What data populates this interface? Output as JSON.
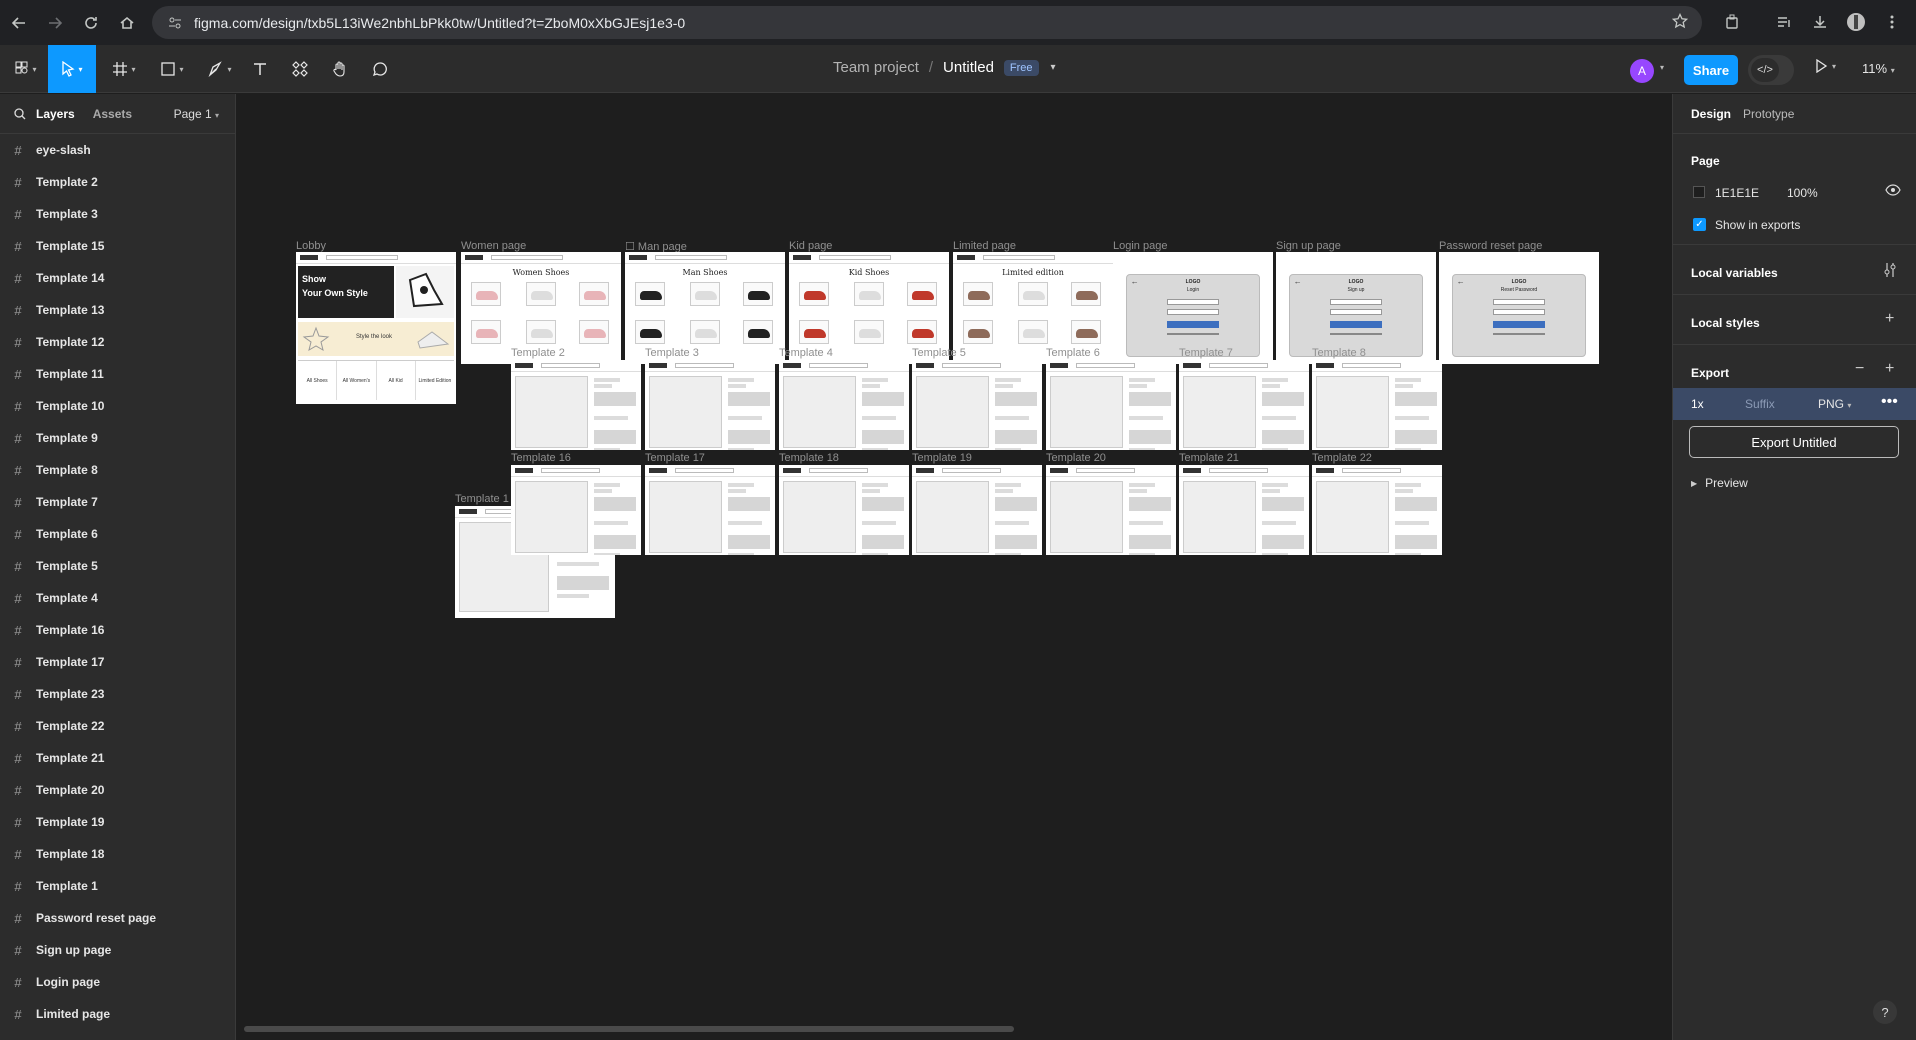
{
  "browser": {
    "url": "figma.com/design/txb5L13iWe2nbhLbPkk0tw/Untitled?t=ZboM0xXbGJEsj1e3-0"
  },
  "toolbar": {
    "team_name": "Team project",
    "separator": "/",
    "file_name": "Untitled",
    "plan_badge": "Free",
    "avatar_initial": "A",
    "share_label": "Share",
    "zoom": "11%"
  },
  "left_panel": {
    "tab_layers": "Layers",
    "tab_assets": "Assets",
    "page_select": "Page 1",
    "layers": [
      "eye-slash",
      "Template 2",
      "Template 3",
      "Template 15",
      "Template 14",
      "Template 13",
      "Template 12",
      "Template 11",
      "Template 10",
      "Template 9",
      "Template 8",
      "Template 7",
      "Template 6",
      "Template 5",
      "Template 4",
      "Template 16",
      "Template 17",
      "Template 23",
      "Template 22",
      "Template 21",
      "Template 20",
      "Template 19",
      "Template 18",
      "Template 1",
      "Password reset page",
      "Sign up page",
      "Login page",
      "Limited page"
    ]
  },
  "canvas": {
    "frames": {
      "lobby": "Lobby",
      "women": "Women page",
      "man": "Man page",
      "kid": "Kid page",
      "limited": "Limited page",
      "login": "Login page",
      "signup": "Sign up page",
      "reset": "Password reset page",
      "t1": "Template 1",
      "row2": [
        "Template 2",
        "Template 3",
        "Template 4",
        "Template 5",
        "Template 6",
        "Template 7",
        "Template 8"
      ],
      "row3": [
        "Template 16",
        "Template 17",
        "Template 18",
        "Template 19",
        "Template 20",
        "Template 21",
        "Template 22"
      ]
    },
    "frame_contents": {
      "lobby_hero_line1": "Show",
      "lobby_hero_line2": "Your Own Style",
      "lobby_banner": "Style the look",
      "lobby_categories": [
        "All Shoes",
        "All Women's",
        "All Kid",
        "Limited Edition"
      ],
      "women_heading": "Women Shoes",
      "man_heading": "Man Shoes",
      "kid_heading": "Kid Shoes",
      "limited_heading": "Limited edition",
      "login_heading": "Login",
      "signup_heading": "Sign up",
      "reset_heading": "Reset Password"
    }
  },
  "right_panel": {
    "tab_design": "Design",
    "tab_prototype": "Prototype",
    "page_heading": "Page",
    "page_color": "1E1E1E",
    "page_opacity": "100%",
    "show_in_exports": "Show in exports",
    "local_variables": "Local variables",
    "local_styles": "Local styles",
    "export_heading": "Export",
    "export_scale": "1x",
    "export_suffix": "Suffix",
    "export_format": "PNG",
    "export_button": "Export Untitled",
    "preview": "Preview",
    "help": "?"
  },
  "colors": {
    "accent": "#0d99ff",
    "canvas_bg": "#1e1e1e",
    "panel_bg": "#2c2c2c"
  }
}
